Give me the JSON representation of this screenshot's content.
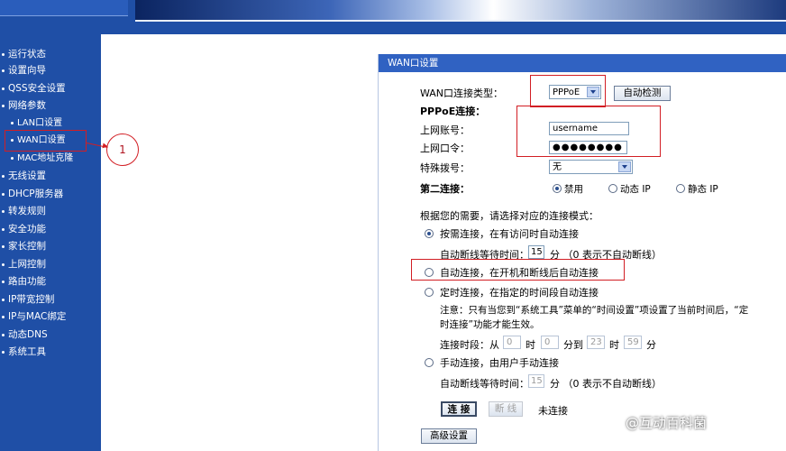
{
  "sidebar": {
    "items": [
      {
        "label": "运行状态"
      },
      {
        "label": "设置向导"
      },
      {
        "label": "QSS安全设置"
      },
      {
        "label": "网络参数"
      },
      {
        "label": "LAN口设置"
      },
      {
        "label": "WAN口设置"
      },
      {
        "label": "MAC地址克隆"
      },
      {
        "label": "无线设置"
      },
      {
        "label": "DHCP服务器"
      },
      {
        "label": "转发规则"
      },
      {
        "label": "安全功能"
      },
      {
        "label": "家长控制"
      },
      {
        "label": "上网控制"
      },
      {
        "label": "路由功能"
      },
      {
        "label": "IP带宽控制"
      },
      {
        "label": "IP与MAC绑定"
      },
      {
        "label": "动态DNS"
      },
      {
        "label": "系统工具"
      }
    ]
  },
  "annotation": {
    "marker": "1",
    "color": "#d21e24"
  },
  "panel": {
    "title": "WAN口设置",
    "conn_type_label": "WAN口连接类型：",
    "conn_type_value": "PPPoE",
    "detect_button": "自动检测",
    "pppoe_heading": "PPPoE连接：",
    "account_label": "上网账号：",
    "account_value": "username",
    "password_label": "上网口令：",
    "password_value": "●●●●●●●●",
    "dial_label": "特殊拨号：",
    "dial_value": "无",
    "second_label": "第二连接：",
    "second_options": [
      "禁用",
      "动态 IP",
      "静态 IP"
    ],
    "mode_intro": "根据您的需要，请选择对应的连接模式：",
    "mode_on_demand": "按需连接，在有访问时自动连接",
    "idle_label": "自动断线等待时间：",
    "idle_value": "15",
    "idle_suffix": "分 （0 表示不自动断线）",
    "mode_auto": "自动连接，在开机和断线后自动连接",
    "mode_timed": "定时连接，在指定的时间段自动连接",
    "note_line1": "注意：只有当您到“系统工具”菜单的“时间设置”项设置了当前时间后，“定",
    "note_line2": "时连接”功能才能生效。",
    "period_label": "连接时段：从",
    "period_from_h": "0",
    "period_h1": "时",
    "period_from_m": "0",
    "period_to": "分到",
    "period_to_h": "23",
    "period_h2": "时",
    "period_to_m": "59",
    "period_m2": "分",
    "mode_manual": "手动连接，由用户手动连接",
    "idle2_label": "自动断线等待时间：",
    "idle2_value": "15",
    "idle2_suffix": "分 （0 表示不自动断线）",
    "connect_button": "连 接",
    "disconnect_button": "断 线",
    "status": "未连接",
    "advanced_button": "高级设置"
  },
  "watermark": "@互动百科菌"
}
